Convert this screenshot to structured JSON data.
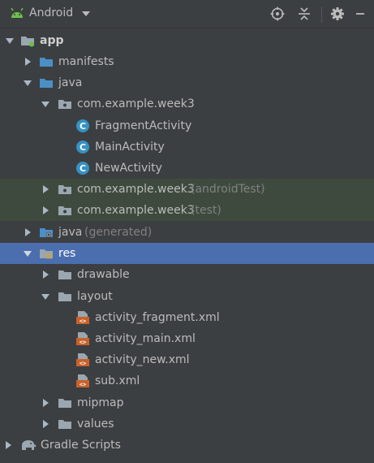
{
  "toolbar": {
    "title": "Android",
    "icons": [
      "android-icon",
      "chevron-down-icon",
      "locate-icon",
      "collapse-all-icon",
      "settings-icon"
    ]
  },
  "tree": {
    "app": "app",
    "manifests": "manifests",
    "java": "java",
    "pkg_main": "com.example.week3",
    "fragment_activity": "FragmentActivity",
    "main_activity": "MainActivity",
    "new_activity": "NewActivity",
    "pkg_android_test": "com.example.week3",
    "pkg_android_test_suffix": "(androidTest)",
    "pkg_test": "com.example.week3",
    "pkg_test_suffix": "(test)",
    "java_generated": "java",
    "java_generated_suffix": "(generated)",
    "res": "res",
    "drawable": "drawable",
    "layout": "layout",
    "activity_fragment": "activity_fragment.xml",
    "activity_main": "activity_main.xml",
    "activity_new": "activity_new.xml",
    "sub": "sub.xml",
    "mipmap": "mipmap",
    "values": "values",
    "gradle_scripts": "Gradle Scripts"
  },
  "colors": {
    "background": "#3c3f41",
    "selection": "#4b6eaf",
    "test_source_bg": "#3f4a3f",
    "folder_blue": "#4b8fc7",
    "class_icon": "#3592c4",
    "xml_icon": "#c9622a",
    "android_green": "#6cc04a"
  }
}
